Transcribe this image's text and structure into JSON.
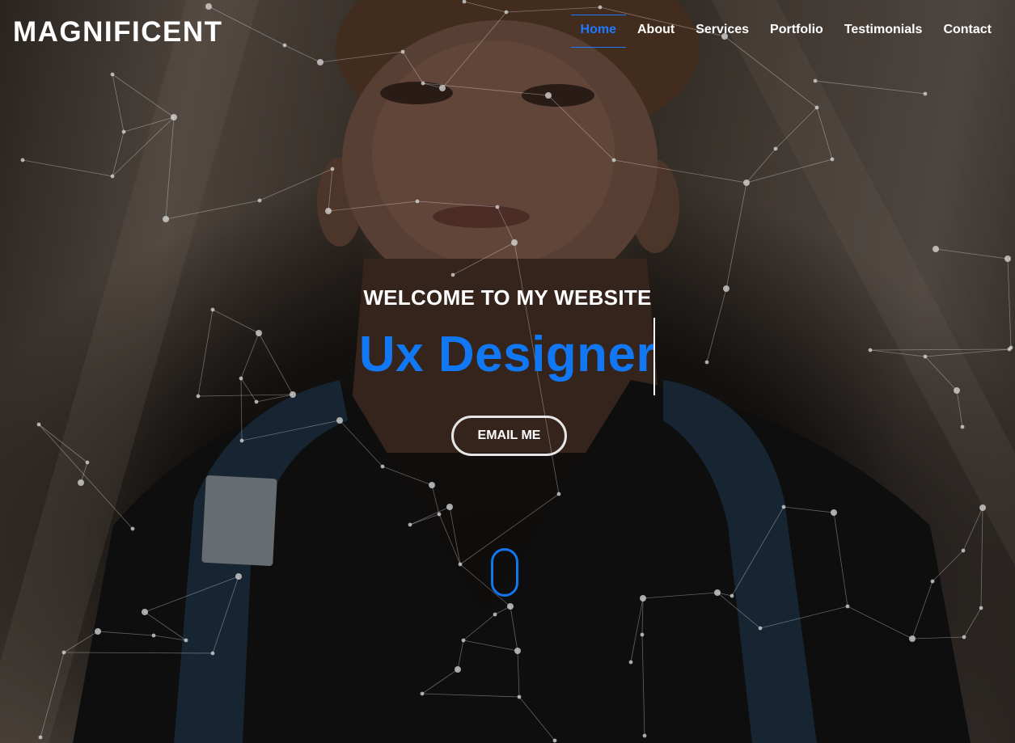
{
  "brand": {
    "logo_text": "MAGNIFICENT"
  },
  "nav": {
    "items": [
      {
        "label": "Home",
        "active": true
      },
      {
        "label": "About",
        "active": false
      },
      {
        "label": "Services",
        "active": false
      },
      {
        "label": "Portfolio",
        "active": false
      },
      {
        "label": "Testimonials",
        "active": false
      },
      {
        "label": "Contact",
        "active": false
      }
    ]
  },
  "hero": {
    "welcome_text": "WELCOME TO MY WEBSITE",
    "typed_text": "Ux Designer",
    "email_button_label": "EMAIL ME"
  },
  "icons": {
    "scroll": "mouse-scroll-icon"
  },
  "colors": {
    "accent": "#1177f3",
    "nav_active": "#1f78ff",
    "text": "#ffffff"
  }
}
